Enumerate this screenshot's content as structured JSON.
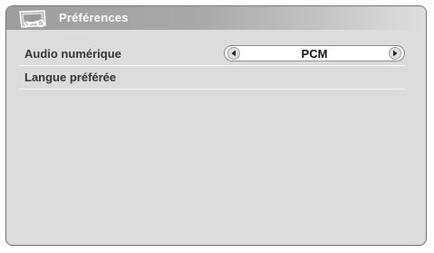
{
  "window": {
    "title": "Préférences",
    "icon": "settings-wrench-icon"
  },
  "menu": {
    "items": [
      {
        "label": "Audio numérique",
        "value": "PCM",
        "prev_icon": "arrow-left-icon",
        "next_icon": "arrow-right-icon"
      },
      {
        "label": "Langue préférée"
      }
    ]
  },
  "colors": {
    "background": "#dcdcdc",
    "title_bar": "#a3a3a3",
    "label_text": "#333333"
  }
}
